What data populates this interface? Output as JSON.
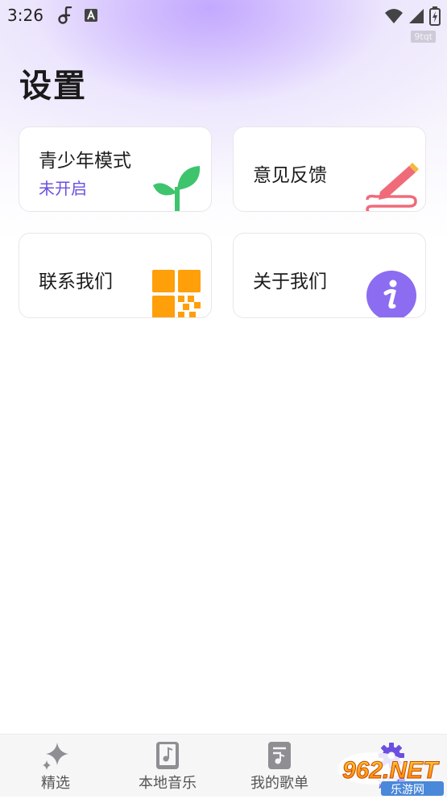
{
  "status_bar": {
    "time": "3:26",
    "icons": [
      "music-note-icon",
      "a-badge-icon",
      "wifi-icon",
      "cellular-signal-icon",
      "battery-charging-icon"
    ]
  },
  "watermark": "9tqt",
  "page": {
    "title": "设置"
  },
  "cards": {
    "youth_mode": {
      "label": "青少年模式",
      "status": "未开启",
      "icon": "sprout-icon"
    },
    "feedback": {
      "label": "意见反馈",
      "icon": "pen-icon"
    },
    "contact": {
      "label": "联系我们",
      "icon": "qr-code-icon"
    },
    "about": {
      "label": "关于我们",
      "icon": "info-icon"
    }
  },
  "tabbar": {
    "tabs": [
      {
        "label": "精选",
        "icon": "sparkle-icon"
      },
      {
        "label": "本地音乐",
        "icon": "local-music-icon"
      },
      {
        "label": "我的歌单",
        "icon": "playlist-icon"
      },
      {
        "label": "设置",
        "icon": "gear-icon",
        "active": true
      }
    ]
  },
  "corner_logo": {
    "main": "962.NET",
    "sub": "乐游网"
  },
  "colors": {
    "accent": "#6c4fe0",
    "sprout": "#3ec46d",
    "pen": "#f06b7a",
    "qr": "#ff9f0a",
    "info": "#8c6cf0"
  }
}
